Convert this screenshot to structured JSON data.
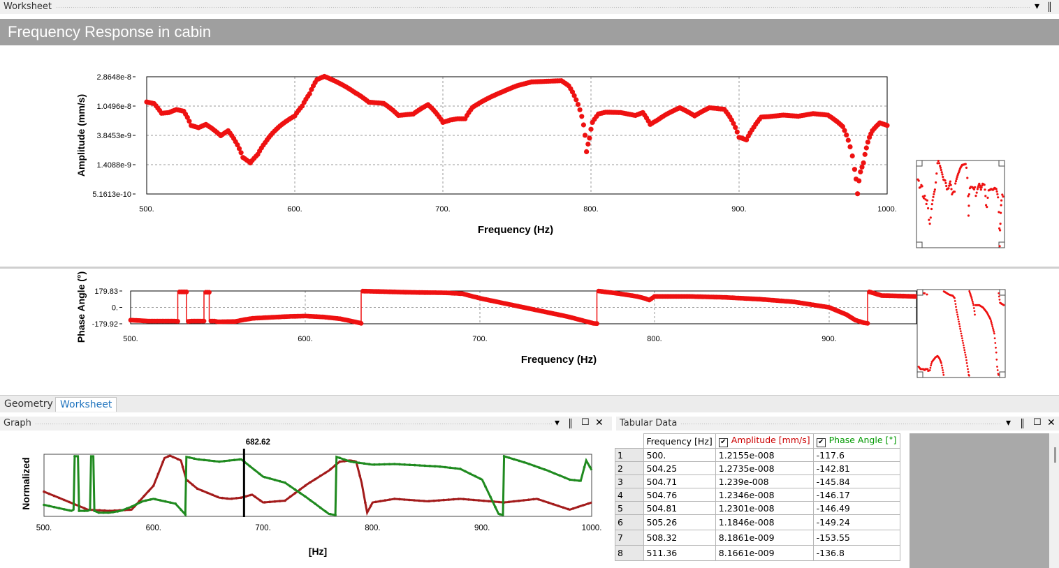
{
  "worksheet_panel": {
    "title": "Worksheet",
    "pin_glyph": "▾",
    "dock_glyph": "║"
  },
  "banner": {
    "title": "Frequency Response  in cabin"
  },
  "tabs": [
    {
      "label": "Geometry",
      "active": false
    },
    {
      "label": "Worksheet",
      "active": true
    }
  ],
  "graph_panel": {
    "title": "Graph",
    "cursor_value": "682.62",
    "ylabel": "Normalized",
    "xlabel": "[Hz]",
    "xticks": [
      "500.",
      "600.",
      "700.",
      "800.",
      "900.",
      "1000."
    ]
  },
  "tabular_panel": {
    "title": "Tabular Data",
    "columns": [
      "Frequency [Hz]",
      "Amplitude [mm/s]",
      "Phase Angle [°]"
    ],
    "column_colors": [
      "#000000",
      "#cc0000",
      "#009900"
    ],
    "rows": [
      [
        "1",
        "500.",
        "1.2155e-008",
        "-117.6"
      ],
      [
        "2",
        "504.25",
        "1.2735e-008",
        "-142.81"
      ],
      [
        "3",
        "504.71",
        "1.239e-008",
        "-145.84"
      ],
      [
        "4",
        "504.76",
        "1.2346e-008",
        "-146.17"
      ],
      [
        "5",
        "504.81",
        "1.2301e-008",
        "-146.49"
      ],
      [
        "6",
        "505.26",
        "1.1846e-008",
        "-149.24"
      ],
      [
        "7",
        "508.32",
        "8.1861e-009",
        "-153.55"
      ],
      [
        "8",
        "511.36",
        "8.1661e-009",
        "-136.8"
      ]
    ]
  },
  "chart_data": [
    {
      "type": "scatter",
      "name": "amplitude",
      "title": "",
      "xlabel": "Frequency (Hz)",
      "ylabel": "Amplitude (mm/s)",
      "yscale": "log",
      "xlim": [
        500,
        1000
      ],
      "ylim": [
        5.1613e-10,
        2.8648e-08
      ],
      "x_tick_labels": [
        "500.",
        "600.",
        "700.",
        "800.",
        "900.",
        "1000."
      ],
      "y_tick_labels": [
        "2.8648e-8",
        "1.0496e-8",
        "3.8453e-9",
        "1.4088e-9",
        "5.1613e-10"
      ],
      "grid": true,
      "color": "#ee1111",
      "x": [
        500,
        505,
        510,
        515,
        520,
        525,
        530,
        535,
        540,
        545,
        550,
        555,
        560,
        565,
        570,
        575,
        580,
        590,
        600,
        605,
        610,
        615,
        620,
        625,
        630,
        640,
        650,
        660,
        670,
        680,
        690,
        700,
        705,
        710,
        715,
        720,
        730,
        740,
        750,
        760,
        770,
        780,
        785,
        790,
        795,
        797,
        799,
        801,
        805,
        810,
        820,
        830,
        835,
        840,
        845,
        850,
        860,
        870,
        880,
        890,
        900,
        905,
        910,
        915,
        920,
        930,
        940,
        950,
        960,
        970,
        975,
        978,
        980,
        982,
        984,
        986,
        988,
        990,
        995,
        1000
      ],
      "y": [
        1.21e-08,
        1.14e-08,
        8.2e-09,
        8.4e-09,
        9.3e-09,
        8.8e-09,
        5.4e-09,
        5e-09,
        5.6e-09,
        4.7e-09,
        3.8e-09,
        4.5e-09,
        3.1e-09,
        1.8e-09,
        1.5e-09,
        2e-09,
        3e-09,
        5.3e-09,
        7.5e-09,
        1.05e-08,
        1.6e-08,
        2.6e-08,
        2.9e-08,
        2.6e-08,
        2.3e-08,
        1.7e-08,
        1.2e-08,
        1.15e-08,
        7.6e-09,
        8e-09,
        1.1e-08,
        6e-09,
        6.5e-09,
        6.8e-09,
        6.8e-09,
        1e-08,
        1.35e-08,
        1.7e-08,
        2.1e-08,
        2.4e-08,
        2.45e-08,
        2.5e-08,
        2.1e-08,
        1.3e-08,
        5.5e-09,
        2.2e-09,
        3.5e-09,
        6e-09,
        8e-09,
        8.5e-09,
        8.4e-09,
        7.6e-09,
        8.4e-09,
        5.6e-09,
        6.5e-09,
        7.7e-09,
        9.9e-09,
        7.5e-09,
        9.9e-09,
        9.4e-09,
        3.6e-09,
        3.3e-09,
        5.1e-09,
        7.2e-09,
        7.3e-09,
        7.7e-09,
        7.4e-09,
        8.1e-09,
        7.7e-09,
        5.2e-09,
        2.6e-09,
        1.2e-09,
        5.2e-10,
        1.1e-09,
        1.5e-09,
        2.5e-09,
        3.6e-09,
        4.5e-09,
        5.9e-09,
        5.4e-09
      ]
    },
    {
      "type": "scatter",
      "name": "phase",
      "title": "",
      "xlabel": "Frequency (Hz)",
      "ylabel": "Phase Angle (°)",
      "xlim": [
        500,
        950
      ],
      "ylim": [
        -179.92,
        179.83
      ],
      "x_tick_labels": [
        "500.",
        "600.",
        "700.",
        "800.",
        "900."
      ],
      "y_tick_labels": [
        "179.83",
        "0.",
        "-179.92"
      ],
      "grid": true,
      "color": "#ee1111",
      "x": [
        500,
        505,
        510,
        520,
        525,
        527,
        528,
        530,
        532,
        533,
        535,
        540,
        542,
        543,
        545,
        546,
        548,
        550,
        560,
        565,
        570,
        580,
        590,
        600,
        610,
        620,
        630,
        632,
        633,
        640,
        650,
        660,
        670,
        680,
        690,
        700,
        710,
        720,
        730,
        740,
        750,
        760,
        765,
        767,
        768,
        780,
        790,
        795,
        797,
        800,
        820,
        840,
        860,
        880,
        900,
        910,
        915,
        920,
        922,
        923,
        930,
        940,
        950
      ],
      "y": [
        -140,
        -145,
        -150,
        -150,
        -150,
        -153,
        170,
        170,
        170,
        -155,
        -150,
        -150,
        -150,
        165,
        165,
        -150,
        -150,
        -158,
        -155,
        -135,
        -120,
        -110,
        -100,
        -95,
        -105,
        -125,
        -165,
        -175,
        178,
        175,
        170,
        165,
        162,
        160,
        150,
        100,
        60,
        20,
        -20,
        -60,
        -100,
        -150,
        -175,
        -178,
        179,
        150,
        120,
        95,
        80,
        120,
        120,
        110,
        90,
        60,
        0,
        -80,
        -140,
        -170,
        -175,
        170,
        130,
        125,
        120
      ]
    },
    {
      "type": "line",
      "name": "normalized",
      "title": "",
      "xlabel": "[Hz]",
      "ylabel": "Normalized",
      "xlim": [
        500,
        1000
      ],
      "ylim": [
        0,
        1
      ],
      "x_tick_labels": [
        "500.",
        "600.",
        "700.",
        "800.",
        "900.",
        "1000."
      ],
      "cursor_x": 682.62,
      "series": [
        {
          "color": "#a31b1b",
          "x": [
            500,
            520,
            540,
            560,
            580,
            590,
            600,
            610,
            615,
            625,
            630,
            640,
            660,
            670,
            680,
            690,
            700,
            720,
            740,
            760,
            770,
            780,
            785,
            790,
            795,
            800,
            810,
            820,
            850,
            880,
            900,
            920,
            950,
            980,
            1000
          ],
          "y": [
            0.4,
            0.25,
            0.1,
            0.08,
            0.1,
            0.3,
            0.5,
            0.96,
            1.0,
            0.92,
            0.6,
            0.45,
            0.3,
            0.28,
            0.3,
            0.35,
            0.22,
            0.25,
            0.52,
            0.75,
            0.9,
            0.92,
            0.9,
            0.55,
            0.05,
            0.22,
            0.25,
            0.28,
            0.24,
            0.28,
            0.25,
            0.22,
            0.28,
            0.1,
            0.22
          ]
        },
        {
          "color": "#1f8a1f",
          "x": [
            500,
            520,
            525,
            527,
            528,
            531,
            532,
            540,
            542,
            543,
            545,
            546,
            550,
            560,
            570,
            580,
            590,
            600,
            620,
            625,
            629,
            630,
            640,
            660,
            680,
            700,
            720,
            740,
            760,
            766,
            767,
            780,
            800,
            820,
            840,
            860,
            880,
            900,
            915,
            919,
            920,
            940,
            960,
            980,
            990,
            995,
            1000
          ],
          "y": [
            0.18,
            0.1,
            0.08,
            0.1,
            0.99,
            0.99,
            0.08,
            0.08,
            0.1,
            0.99,
            0.99,
            0.08,
            0.05,
            0.05,
            0.08,
            0.15,
            0.24,
            0.28,
            0.2,
            0.1,
            0.02,
            0.98,
            0.94,
            0.9,
            0.94,
            0.65,
            0.55,
            0.3,
            0.03,
            0.01,
            0.98,
            0.9,
            0.85,
            0.86,
            0.84,
            0.82,
            0.78,
            0.6,
            0.03,
            0.01,
            0.99,
            0.88,
            0.75,
            0.6,
            0.58,
            0.92,
            0.76
          ]
        }
      ]
    }
  ]
}
